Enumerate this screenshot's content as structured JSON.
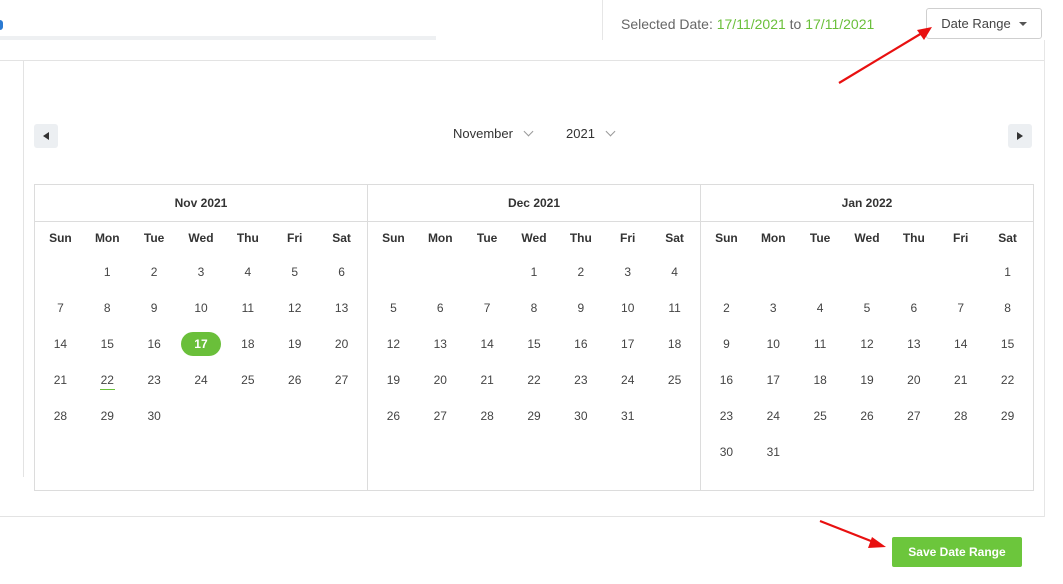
{
  "header": {
    "selected_label": "Selected Date:",
    "from_date": "17/11/2021",
    "to_word": "to",
    "to_date": "17/11/2021",
    "date_range_label": "Date Range"
  },
  "picker": {
    "month_value": "November",
    "year_value": "2021"
  },
  "weekdays": [
    "Sun",
    "Mon",
    "Tue",
    "Wed",
    "Thu",
    "Fri",
    "Sat"
  ],
  "months": [
    {
      "title": "Nov 2021",
      "weeks": [
        [
          "",
          "1",
          "2",
          "3",
          "4",
          "5",
          "6"
        ],
        [
          "7",
          "8",
          "9",
          "10",
          "11",
          "12",
          "13"
        ],
        [
          "14",
          "15",
          "16",
          "17",
          "18",
          "19",
          "20"
        ],
        [
          "21",
          "22",
          "23",
          "24",
          "25",
          "26",
          "27"
        ],
        [
          "28",
          "29",
          "30",
          "",
          "",
          "",
          ""
        ]
      ]
    },
    {
      "title": "Dec 2021",
      "weeks": [
        [
          "",
          "",
          "",
          "1",
          "2",
          "3",
          "4"
        ],
        [
          "5",
          "6",
          "7",
          "8",
          "9",
          "10",
          "11"
        ],
        [
          "12",
          "13",
          "14",
          "15",
          "16",
          "17",
          "18"
        ],
        [
          "19",
          "20",
          "21",
          "22",
          "23",
          "24",
          "25"
        ],
        [
          "26",
          "27",
          "28",
          "29",
          "30",
          "31",
          ""
        ]
      ]
    },
    {
      "title": "Jan 2022",
      "weeks": [
        [
          "",
          "",
          "",
          "",
          "",
          "",
          "1"
        ],
        [
          "2",
          "3",
          "4",
          "5",
          "6",
          "7",
          "8"
        ],
        [
          "9",
          "10",
          "11",
          "12",
          "13",
          "14",
          "15"
        ],
        [
          "16",
          "17",
          "18",
          "19",
          "20",
          "21",
          "22"
        ],
        [
          "23",
          "24",
          "25",
          "26",
          "27",
          "28",
          "29"
        ],
        [
          "30",
          "31",
          "",
          "",
          "",
          "",
          ""
        ]
      ]
    }
  ],
  "selected_day": "17",
  "today_day": "22",
  "footer": {
    "save_label": "Save Date Range"
  },
  "colors": {
    "accent_green": "#6abf3a",
    "save_green": "#6cc63c",
    "arrow_red": "#e81010"
  }
}
